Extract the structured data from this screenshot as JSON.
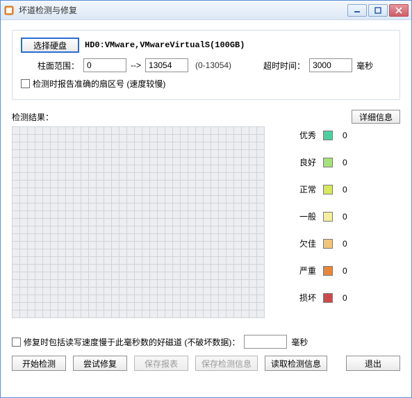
{
  "title": "坏道检测与修复",
  "select_disk_btn": "选择硬盘",
  "disk_info": "HD0:VMware,VMwareVirtualS(100GB)",
  "cylinder_range_label": "柱面范围：",
  "cylinder_start": "0",
  "cylinder_arrow": "-->",
  "cylinder_end": "13054",
  "cylinder_hint": "(0-13054)",
  "timeout_label": "超时时间：",
  "timeout_value": "3000",
  "timeout_unit": "毫秒",
  "accurate_sector_checkbox": "检测时报告准确的扇区号 (速度较慢)",
  "result_label": "检测结果：",
  "details_btn": "详细信息",
  "legend": [
    {
      "label": "优秀",
      "color": "#4dd0a0",
      "count": "0"
    },
    {
      "label": "良好",
      "color": "#a8e079",
      "count": "0"
    },
    {
      "label": "正常",
      "color": "#d7e85c",
      "count": "0"
    },
    {
      "label": "一般",
      "color": "#f5ef9e",
      "count": "0"
    },
    {
      "label": "欠佳",
      "color": "#f2c37a",
      "count": "0"
    },
    {
      "label": "严重",
      "color": "#e88639",
      "count": "0"
    },
    {
      "label": "损坏",
      "color": "#c94b4b",
      "count": "0"
    }
  ],
  "repair_checkbox_text": "修复时包括读写速度慢于此毫秒数的好磁道 (不破坏数据)：",
  "repair_ms_value": "",
  "repair_ms_unit": "毫秒",
  "buttons": {
    "start": "开始检测",
    "try_repair": "尝试修复",
    "save_report": "保存报表",
    "save_info": "保存检测信息",
    "load_info": "读取检测信息",
    "exit": "退出"
  },
  "grid": {
    "cols": 33,
    "rows": 25,
    "cell": 11
  }
}
